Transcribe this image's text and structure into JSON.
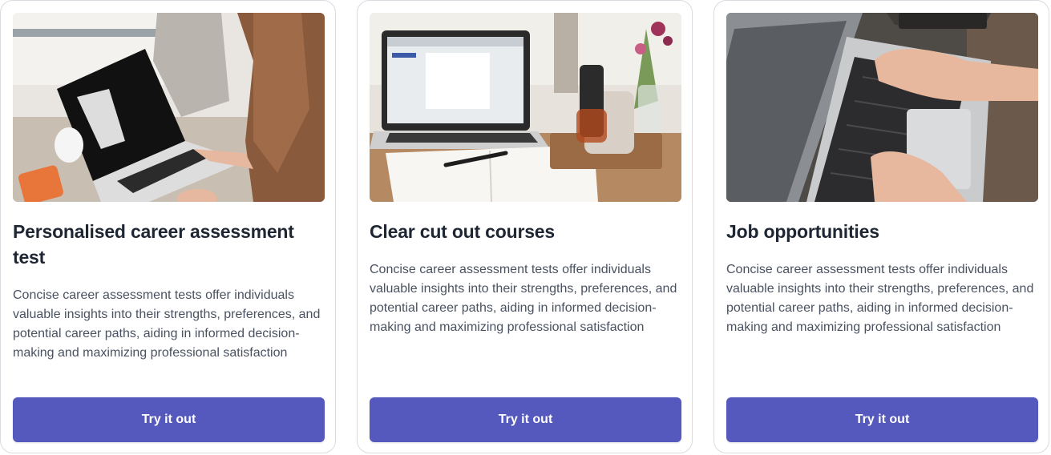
{
  "cards": [
    {
      "image_icon": "photo-woman-typing-on-laptop",
      "title": "Personalised career assessment test",
      "description": "Concise career assessment tests offer individuals valuable insights into their strengths, preferences, and potential career paths, aiding in informed decision-making and maximizing professional satisfaction",
      "button_label": "Try it out"
    },
    {
      "image_icon": "photo-laptop-notebook-coffee-mug",
      "title": "Clear cut out courses",
      "description": "Concise career assessment tests offer individuals valuable insights into their strengths, preferences, and potential career paths, aiding in informed decision-making and maximizing professional satisfaction",
      "button_label": "Try it out"
    },
    {
      "image_icon": "photo-hands-typing-on-keyboard",
      "title": "Job opportunities",
      "description": "Concise career assessment tests offer individuals valuable insights into their strengths, preferences, and potential career paths, aiding in informed decision-making and maximizing professional satisfaction",
      "button_label": "Try it out"
    }
  ],
  "colors": {
    "button": "#5559bd",
    "title": "#1f2633",
    "body_text": "#4a5261",
    "card_border": "#d9dbe1"
  }
}
